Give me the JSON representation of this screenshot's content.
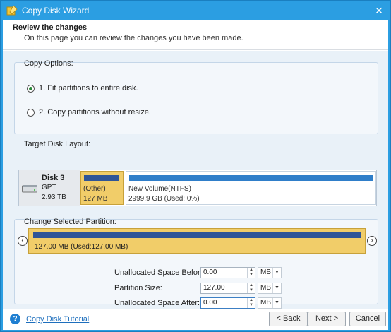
{
  "window": {
    "title": "Copy Disk Wizard",
    "close_glyph": "✕"
  },
  "header": {
    "title": "Review the changes",
    "subtitle": "On this page you can review the changes you have been made."
  },
  "copy_options": {
    "label": "Copy Options:",
    "options": [
      {
        "label": "1. Fit partitions to entire disk.",
        "selected": true
      },
      {
        "label": "2. Copy partitions without resize.",
        "selected": false
      }
    ]
  },
  "target_layout": {
    "label": "Target Disk Layout:",
    "disk": {
      "name": "Disk 3",
      "type": "GPT",
      "size": "2.93 TB"
    },
    "partitions": [
      {
        "name": "(Other)",
        "size": "127 MB",
        "color": "#f1cd69"
      },
      {
        "name": "New Volume(NTFS)",
        "size": "2999.9 GB (Used: 0%)",
        "color": "#2f7ec9"
      }
    ]
  },
  "change_partition": {
    "label": "Change Selected Partition:",
    "selected_label": "127.00 MB (Used:127.00 MB)",
    "fields": [
      {
        "label": "Unallocated Space Before:",
        "value": "0.00",
        "unit": "MB"
      },
      {
        "label": "Partition Size:",
        "value": "127.00",
        "unit": "MB"
      },
      {
        "label": "Unallocated Space After:",
        "value": "0.00",
        "unit": "MB"
      }
    ]
  },
  "footer": {
    "tutorial_link": "Copy Disk Tutorial",
    "back": "< Back",
    "next": "Next >",
    "cancel": "Cancel"
  },
  "colors": {
    "titlebar": "#2b9ee2",
    "selected_partition": "#f1cd69",
    "accent": "#2f5597"
  },
  "icons": [
    "wizard-icon",
    "close-icon",
    "hdd-icon",
    "left-arrow-icon",
    "right-arrow-icon",
    "help-icon",
    "spin-up-icon",
    "spin-down-icon",
    "dropdown-icon"
  ]
}
